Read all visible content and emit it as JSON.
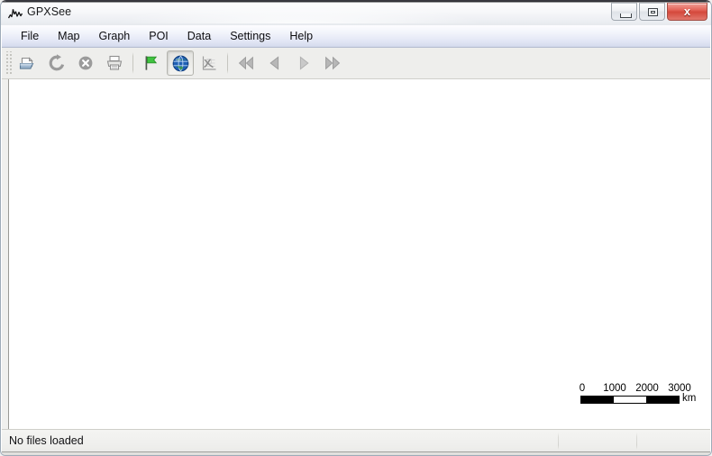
{
  "window": {
    "title": "GPXSee",
    "app_icon": "elevation-profile-logo-icon",
    "controls": {
      "minimize_label": "Minimize",
      "minimize_icon": "window-minimize-icon",
      "maximize_label": "Maximize",
      "maximize_icon": "window-maximize-icon",
      "close_label": "x",
      "close_icon": "window-close-icon",
      "close_color": "#d4483b"
    }
  },
  "menubar": {
    "items": [
      {
        "label": "File"
      },
      {
        "label": "Map"
      },
      {
        "label": "Graph"
      },
      {
        "label": "POI"
      },
      {
        "label": "Data"
      },
      {
        "label": "Settings"
      },
      {
        "label": "Help"
      }
    ]
  },
  "toolbar": {
    "groups": [
      {
        "name": "file-group",
        "buttons": [
          {
            "name": "open-file-button",
            "icon": "open-folder-icon",
            "label": "Open",
            "enabled": false,
            "checked": false
          },
          {
            "name": "reload-button",
            "icon": "reload-arrow-icon",
            "label": "Reload",
            "enabled": false,
            "checked": false
          },
          {
            "name": "close-file-button",
            "icon": "close-circle-icon",
            "label": "Close",
            "enabled": false,
            "checked": false
          },
          {
            "name": "print-button",
            "icon": "printer-icon",
            "label": "Print",
            "enabled": false,
            "checked": false
          }
        ]
      },
      {
        "name": "view-group",
        "buttons": [
          {
            "name": "show-poi-button",
            "icon": "green-flag-icon",
            "label": "Show POIs",
            "enabled": true,
            "checked": false
          },
          {
            "name": "show-map-button",
            "icon": "globe-icon",
            "label": "Show map",
            "enabled": true,
            "checked": true
          },
          {
            "name": "show-graphs-button",
            "icon": "line-graph-icon",
            "label": "Show graphs",
            "enabled": false,
            "checked": false
          }
        ]
      },
      {
        "name": "navigation-group",
        "buttons": [
          {
            "name": "first-button",
            "icon": "skip-to-first-icon",
            "label": "First",
            "enabled": false,
            "checked": false
          },
          {
            "name": "previous-button",
            "icon": "step-previous-icon",
            "label": "Previous",
            "enabled": false,
            "checked": false
          },
          {
            "name": "next-button",
            "icon": "step-next-icon",
            "label": "Next",
            "enabled": false,
            "checked": false
          },
          {
            "name": "last-button",
            "icon": "skip-to-last-icon",
            "label": "Last",
            "enabled": false,
            "checked": false
          }
        ]
      }
    ]
  },
  "map": {
    "background_color": "#ffffff",
    "content": "",
    "scale": {
      "labels": [
        "0",
        "1000",
        "2000",
        "3000"
      ],
      "unit": "km",
      "segments": [
        "dark",
        "light",
        "dark"
      ]
    }
  },
  "statusbar": {
    "message": "No files loaded",
    "segment_2": "",
    "segment_3": ""
  }
}
